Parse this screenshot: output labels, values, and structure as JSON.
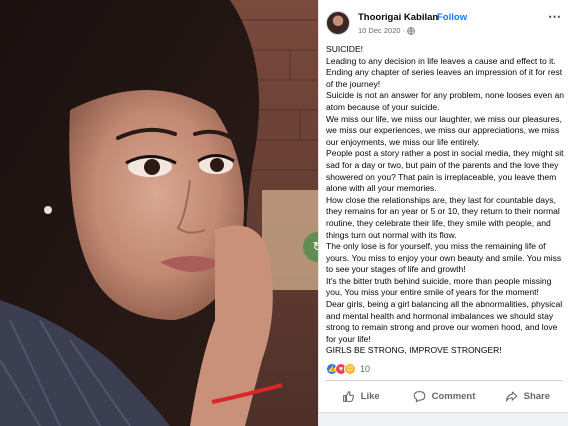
{
  "post": {
    "author": "Thoorigai Kabilan",
    "separator": "·",
    "follow_label": "Follow",
    "date": "10 Dec 2020",
    "meta_separator": "·",
    "more_icon": "more-options-icon",
    "paragraphs": [
      "SUICIDE!",
      "Leading to any decision in life leaves a cause and effect to it. Ending any chapter of series leaves an impression of it for rest of the journey!",
      "Suicide is not an answer for any problem, none looses even an atom because of your suicide.",
      "We miss our life, we miss our laughter, we miss our pleasures, we miss our experiences, we miss our appreciations, we miss our enjoyments, we miss our life entirely.",
      "People post a story rather a post in social media, they might sit sad for a day or two, but pain of the parents and the love they showered on you? That pain is irreplaceable, you leave them alone with all your memories.",
      "How close the relationships are, they last for countable days, they remains for an year or 5 or 10, they return to their normal routine, they celebrate their life, they smile with people, and things turn out normal with its flow.",
      "The only lose is for yourself, you miss the remaining life of yours. You miss to enjoy your own beauty and smile. You miss to see your stages of life and growth!",
      "It's the bitter truth behind suicide, more than people missing you, You miss your entire smile of years for the moment!",
      "Dear girls, being a girl balancing all the abnormalities, physical and mental health and hormonal imbalances we should stay strong to remain strong and prove our women hood, and love for your life!",
      "GIRLS BE STRONG, IMPROVE STRONGER!"
    ],
    "reaction_count": "10",
    "reactions": [
      "like-icon",
      "love-icon",
      "sad-icon"
    ],
    "actions": {
      "like": "Like",
      "comment": "Comment",
      "share": "Share"
    }
  },
  "colors": {
    "follow": "#1877f2",
    "like": "#1877f2",
    "love": "#f33e58",
    "sad": "#f7b125"
  }
}
